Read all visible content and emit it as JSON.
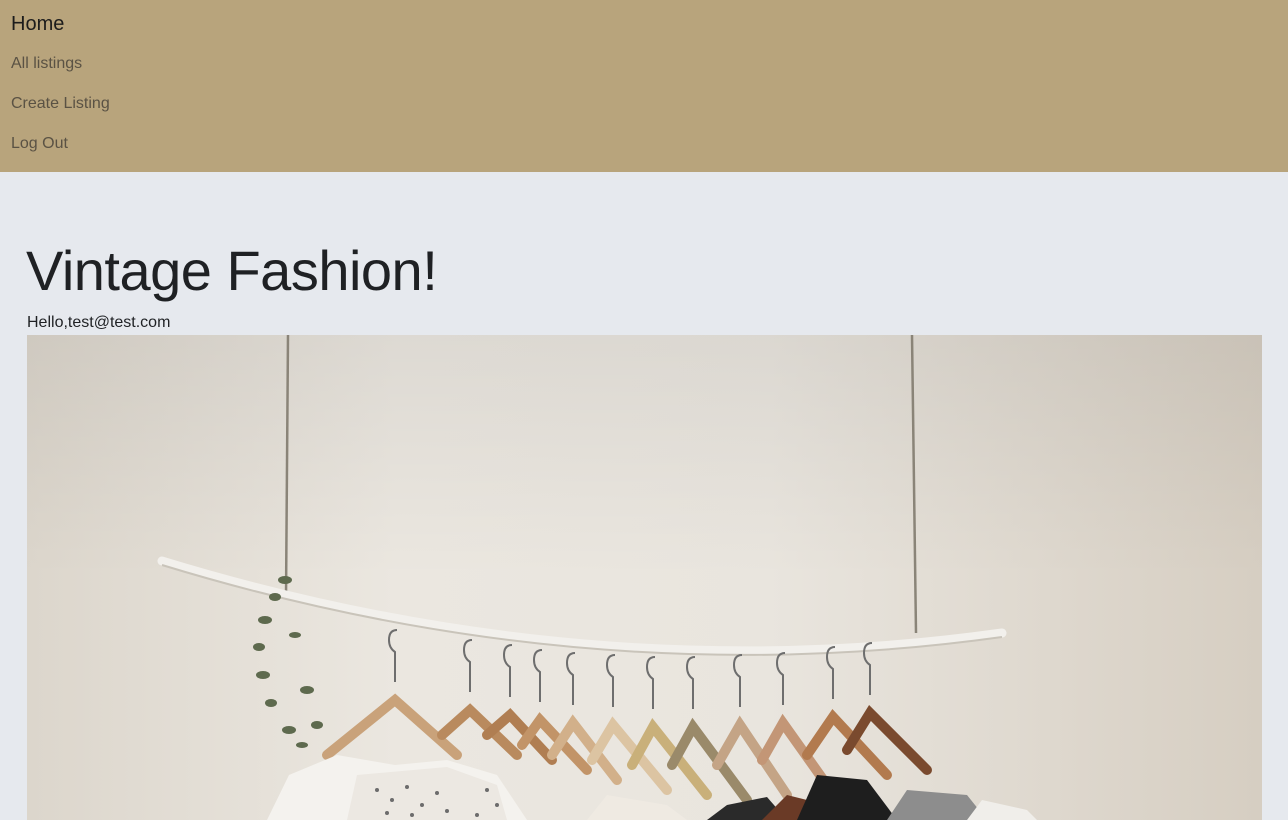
{
  "nav": {
    "brand": "Home",
    "links": [
      "All listings",
      "Create Listing",
      "Log Out"
    ]
  },
  "page": {
    "title": "Vintage Fashion!",
    "greeting": "Hello,test@test.com"
  },
  "hero_image": {
    "alt": "Clothes on wooden hangers on a hanging rail"
  },
  "colors": {
    "navbar_bg": "#b8a47c",
    "page_bg": "#e6e9ee",
    "text": "#1f2124"
  }
}
